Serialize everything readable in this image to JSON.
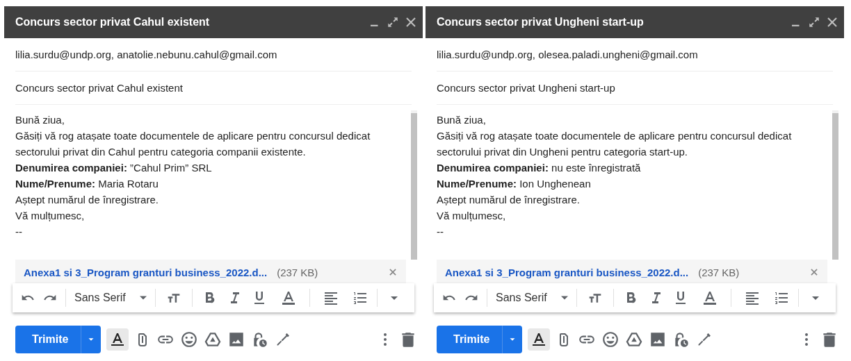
{
  "windows": [
    {
      "title": "Concurs sector privat Cahul existent",
      "to": "lilia.surdu@undp.org, anatolie.nebunu.cahul@gmail.com",
      "subject": "Concurs sector privat Cahul existent",
      "body": [
        "Bună ziua,",
        "Găsiți vă rog atașate toate documentele de aplicare pentru concursul dedicat",
        "sectorului privat din Cahul pentru categoria companii existente.",
        "**Denumirea companiei:** ”Cahul Prim” SRL",
        "**Nume/Prenume:** Maria Rotaru",
        "Aștept numărul de înregistrare.",
        "Vă mulțumesc,",
        "--"
      ],
      "attachment": {
        "name": "Anexa1 si 3_Program granturi business_2022.d...",
        "size": "(237 KB)"
      },
      "font": "Sans Serif",
      "send": "Trimite",
      "formatting_on": true
    },
    {
      "title": "Concurs sector privat Ungheni start-up",
      "to": "lilia.surdu@undp.org, olesea.paladi.ungheni@gmail.com",
      "subject": "Concurs sector privat Ungheni start-up",
      "body": [
        "Bună ziua,",
        "Găsiți vă rog atașate toate documentele de aplicare pentru concursul dedicat",
        "sectorului privat din Ungheni pentru categoria start-up.",
        "**Denumirea companiei:** nu este înregistrată",
        "**Nume/Prenume:** Ion Unghenean",
        "Aștept numărul de înregistrare.",
        "Vă mulțumesc,",
        "--"
      ],
      "attachment": {
        "name": "Anexa1 si 3_Program granturi business_2022.d...",
        "size": "(237 KB)"
      },
      "font": "Sans Serif",
      "send": "Trimite",
      "formatting_on": true
    }
  ]
}
